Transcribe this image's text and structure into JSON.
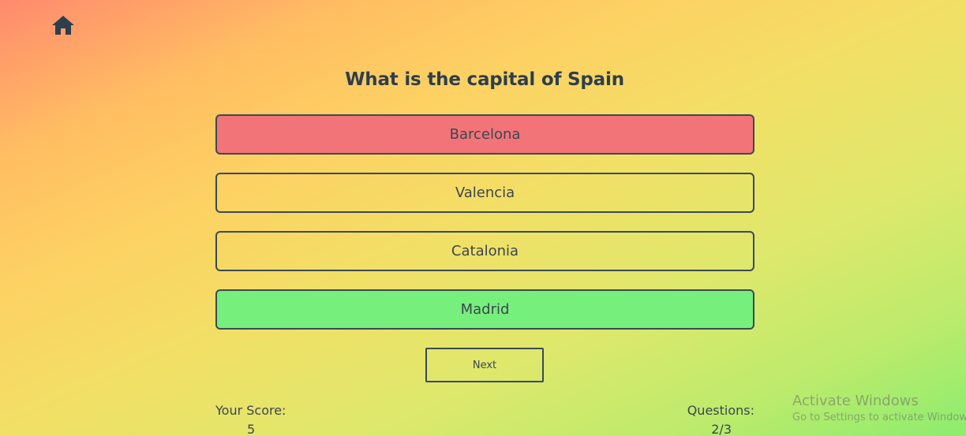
{
  "nav": {
    "home_icon": "home-icon"
  },
  "quiz": {
    "question": "What is the capital of Spain",
    "options": [
      {
        "label": "Barcelona",
        "state": "wrong"
      },
      {
        "label": "Valencia",
        "state": "neutral"
      },
      {
        "label": "Catalonia",
        "state": "neutral"
      },
      {
        "label": "Madrid",
        "state": "correct"
      }
    ],
    "next_label": "Next"
  },
  "footer": {
    "score_label": "Your Score:",
    "score_value": "5",
    "questions_label": "Questions:",
    "questions_value": "2/3"
  },
  "watermark": {
    "title": "Activate Windows",
    "subtitle": "Go to Settings to activate Windows."
  },
  "colors": {
    "wrong": "#f27478",
    "correct": "#76ef7d",
    "text": "#2d3e4e"
  }
}
